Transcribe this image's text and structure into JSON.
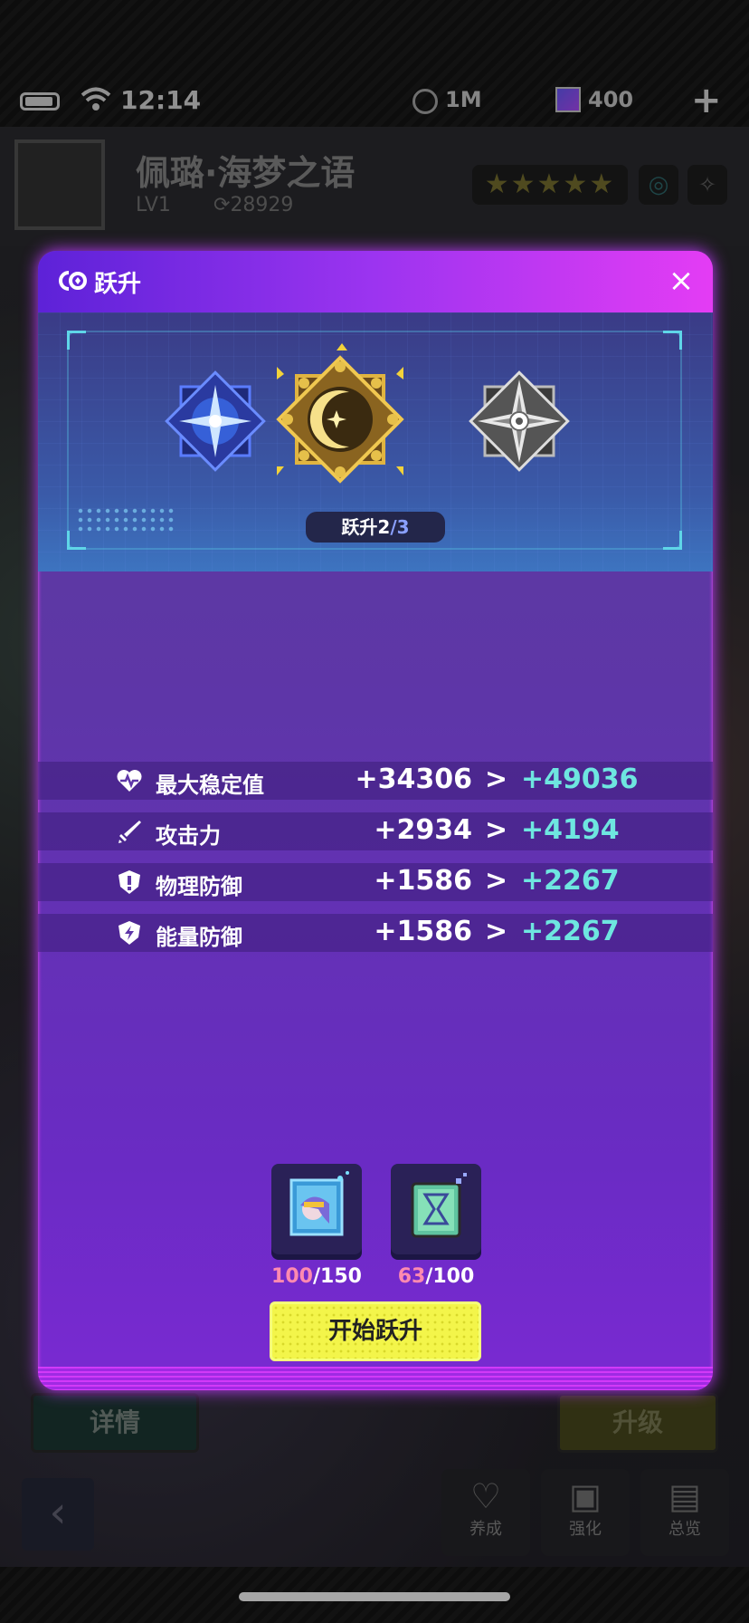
{
  "status_bar": {
    "time": "12:14",
    "coins": "1M",
    "gems": "400",
    "plus": "+"
  },
  "character": {
    "name": "佩璐·海梦之语",
    "level": "LV1",
    "power": "28929",
    "stars": "★★★★★"
  },
  "background": {
    "detail_label": "详情",
    "upgrade_label": "升级",
    "tabs": [
      "养成",
      "强化",
      "总览"
    ]
  },
  "modal": {
    "title": "跃升",
    "close": "×",
    "stage": {
      "current": "跃升2",
      "total": "/3"
    },
    "stats": [
      {
        "name": "最大稳定值",
        "current": "+34306",
        "next": "+49036",
        "icon": "heart-pulse-icon"
      },
      {
        "name": "攻击力",
        "current": "+2934",
        "next": "+4194",
        "icon": "sword-icon"
      },
      {
        "name": "物理防御",
        "current": "+1586",
        "next": "+2267",
        "icon": "shield-exclaim-icon"
      },
      {
        "name": "能量防御",
        "current": "+1586",
        "next": "+2267",
        "icon": "shield-bolt-icon"
      }
    ],
    "arrow": ">",
    "materials": [
      {
        "have": "100",
        "need": "/150",
        "icon": "character-portrait-item-icon"
      },
      {
        "have": "63",
        "need": "/100",
        "icon": "hourglass-card-item-icon"
      }
    ],
    "start_button": "开始跃升"
  },
  "colors": {
    "next_value": "#6ee6e0",
    "have_count": "#ff8ab0",
    "start_button": "#f3f54a",
    "header_gradient_end": "#e43cf4"
  }
}
